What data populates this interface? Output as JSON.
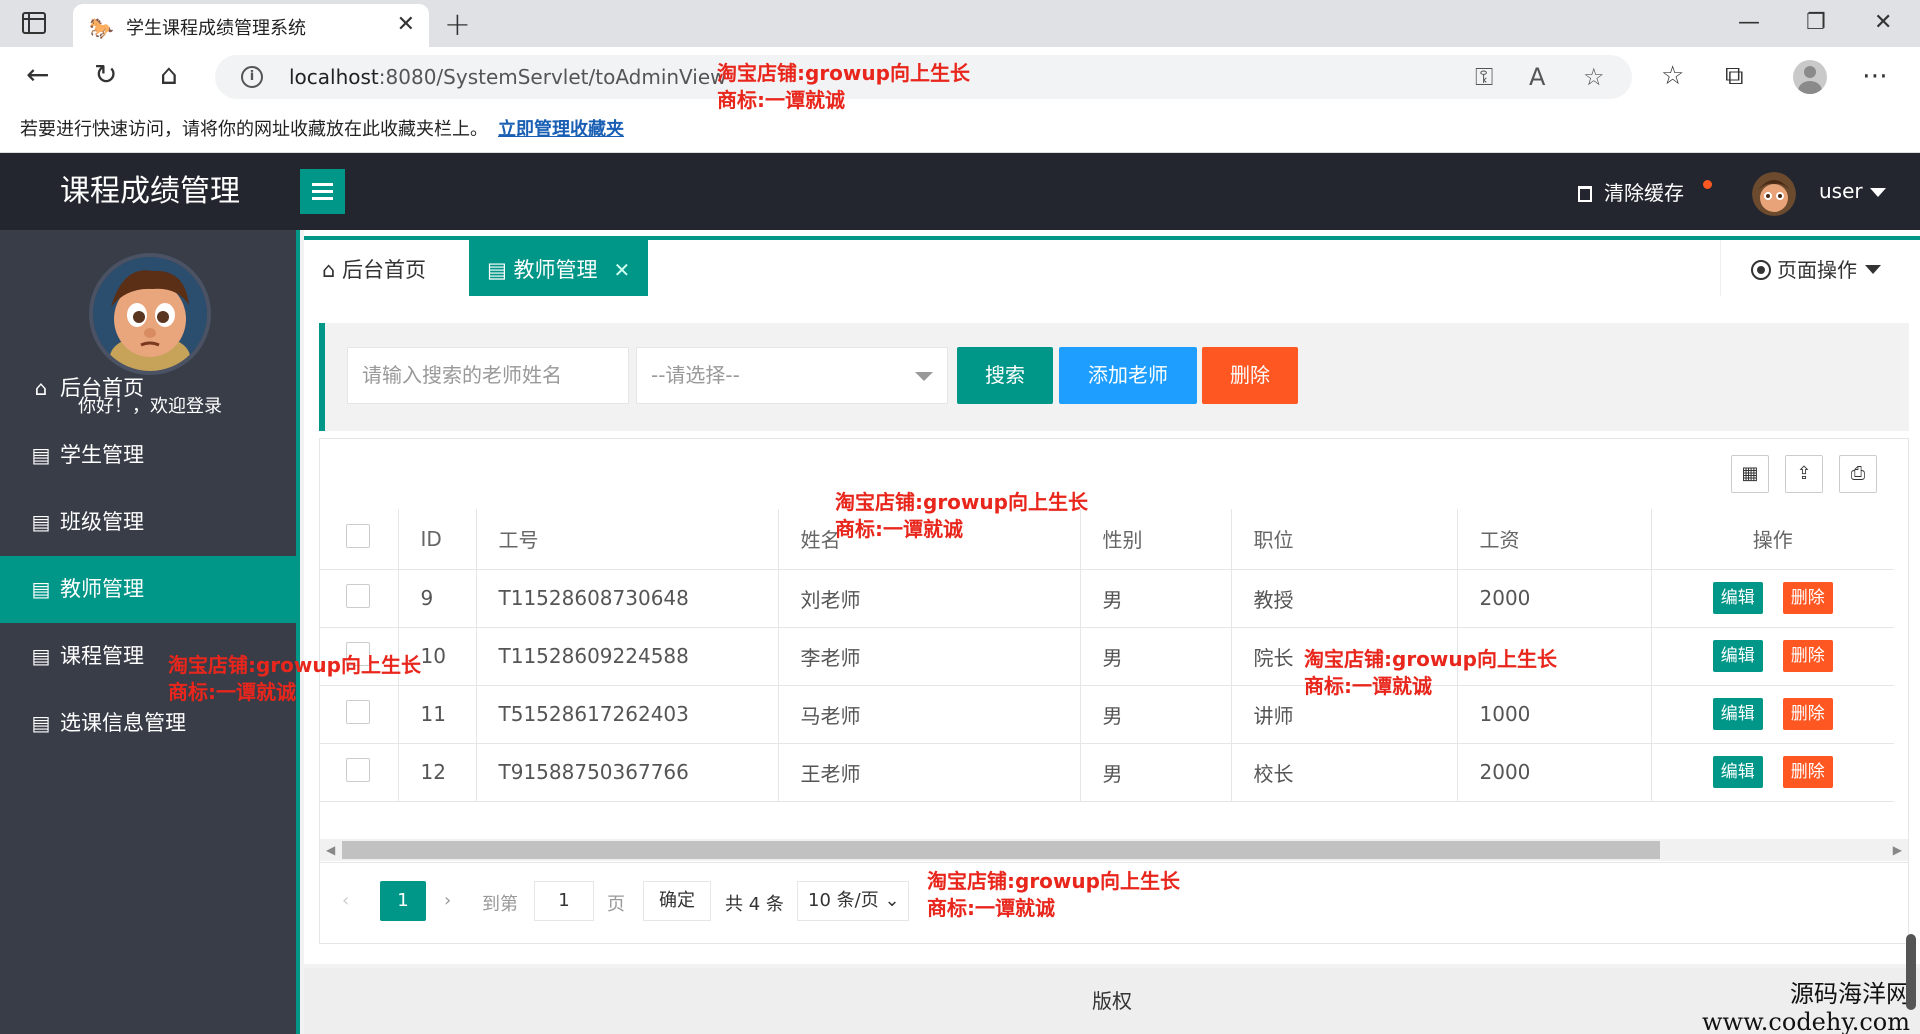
{
  "browser": {
    "tab_title": "学生课程成绩管理系统",
    "url_host": "localhost",
    "url_rest": ":8080/SystemServlet/toAdminView",
    "fav_hint": "若要进行快速访问，请将你的网址收藏放在此收藏夹栏上。",
    "fav_link": "立即管理收藏夹"
  },
  "header": {
    "logo": "课程成绩管理",
    "clear_cache": "清除缓存",
    "user": "user"
  },
  "sidebar": {
    "welcome": "你好！，欢迎登录",
    "items": [
      {
        "label": "后台首页",
        "icon": "home-icon"
      },
      {
        "label": "学生管理",
        "icon": "doc-icon"
      },
      {
        "label": "班级管理",
        "icon": "doc-icon"
      },
      {
        "label": "教师管理",
        "icon": "doc-icon"
      },
      {
        "label": "课程管理",
        "icon": "doc-icon"
      },
      {
        "label": "选课信息管理",
        "icon": "doc-icon"
      }
    ]
  },
  "tabs": {
    "home": "后台首页",
    "teacher": "教师管理",
    "page_ops": "页面操作"
  },
  "search": {
    "placeholder": "请输入搜索的老师姓名",
    "select": "--请选择--",
    "search_btn": "搜索",
    "add_btn": "添加老师",
    "delete_btn": "删除"
  },
  "table": {
    "headers": [
      "ID",
      "工号",
      "姓名",
      "性别",
      "职位",
      "工资",
      "操作"
    ],
    "rows": [
      {
        "id": "9",
        "no": "T11528608730648",
        "name": "刘老师",
        "sex": "男",
        "pos": "教授",
        "salary": "2000"
      },
      {
        "id": "10",
        "no": "T11528609224588",
        "name": "李老师",
        "sex": "男",
        "pos": "院长",
        "salary": ""
      },
      {
        "id": "11",
        "no": "T51528617262403",
        "name": "马老师",
        "sex": "男",
        "pos": "讲师",
        "salary": "1000"
      },
      {
        "id": "12",
        "no": "T91588750367766",
        "name": "王老师",
        "sex": "男",
        "pos": "校长",
        "salary": "2000"
      }
    ],
    "edit": "编辑",
    "del": "删除"
  },
  "pager": {
    "current": "1",
    "goto": "到第",
    "page_input": "1",
    "page_unit": "页",
    "confirm": "确定",
    "total": "共 4 条",
    "per_page": "10 条/页"
  },
  "footer": "版权",
  "watermark": {
    "line1": "淘宝店铺:growup向上生长",
    "line2": "商标:一谭就诚"
  },
  "corner": {
    "line1": "源码海洋网",
    "line2": "www.codehy.com"
  },
  "colors": {
    "primary": "#009688",
    "blue": "#1e9fff",
    "orange": "#ff5722",
    "dark": "#23262e",
    "sidebar": "#383d48"
  }
}
